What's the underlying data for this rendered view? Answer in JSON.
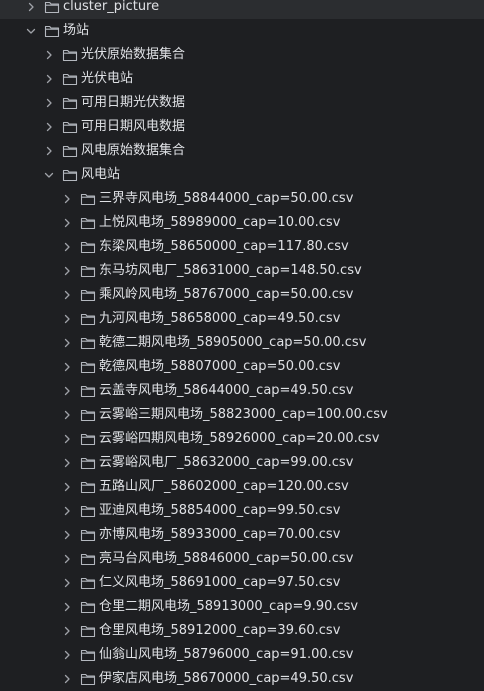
{
  "tree": [
    {
      "label": "cluster_picture",
      "level": 0,
      "expanded": false
    },
    {
      "label": "场站",
      "level": 0,
      "expanded": true
    },
    {
      "label": "光伏原始数据集合",
      "level": 1,
      "expanded": false
    },
    {
      "label": "光伏电站",
      "level": 1,
      "expanded": false
    },
    {
      "label": "可用日期光伏数据",
      "level": 1,
      "expanded": false
    },
    {
      "label": "可用日期风电数据",
      "level": 1,
      "expanded": false
    },
    {
      "label": "风电原始数据集合",
      "level": 1,
      "expanded": false
    },
    {
      "label": "风电站",
      "level": 1,
      "expanded": true
    },
    {
      "label": "三界寺风电场_58844000_cap=50.00.csv",
      "level": 2,
      "expanded": false
    },
    {
      "label": "上悦风电场_58989000_cap=10.00.csv",
      "level": 2,
      "expanded": false
    },
    {
      "label": "东梁风电场_58650000_cap=117.80.csv",
      "level": 2,
      "expanded": false
    },
    {
      "label": "东马坊风电厂_58631000_cap=148.50.csv",
      "level": 2,
      "expanded": false
    },
    {
      "label": "乘风岭风电场_58767000_cap=50.00.csv",
      "level": 2,
      "expanded": false
    },
    {
      "label": "九河风电场_58658000_cap=49.50.csv",
      "level": 2,
      "expanded": false
    },
    {
      "label": "乾德二期风电场_58905000_cap=50.00.csv",
      "level": 2,
      "expanded": false
    },
    {
      "label": "乾德风电场_58807000_cap=50.00.csv",
      "level": 2,
      "expanded": false
    },
    {
      "label": "云盖寺风电场_58644000_cap=49.50.csv",
      "level": 2,
      "expanded": false
    },
    {
      "label": "云雾峪三期风电场_58823000_cap=100.00.csv",
      "level": 2,
      "expanded": false
    },
    {
      "label": "云雾峪四期风电场_58926000_cap=20.00.csv",
      "level": 2,
      "expanded": false
    },
    {
      "label": "云雾峪风电厂_58632000_cap=99.00.csv",
      "level": 2,
      "expanded": false
    },
    {
      "label": "五路山风厂_58602000_cap=120.00.csv",
      "level": 2,
      "expanded": false
    },
    {
      "label": "亚迪风电场_58854000_cap=99.50.csv",
      "level": 2,
      "expanded": false
    },
    {
      "label": "亦博风电场_58933000_cap=70.00.csv",
      "level": 2,
      "expanded": false
    },
    {
      "label": "亮马台风电场_58846000_cap=50.00.csv",
      "level": 2,
      "expanded": false
    },
    {
      "label": "仁义风电场_58691000_cap=97.50.csv",
      "level": 2,
      "expanded": false
    },
    {
      "label": "仓里二期风电场_58913000_cap=9.90.csv",
      "level": 2,
      "expanded": false
    },
    {
      "label": "仓里风电场_58912000_cap=39.60.csv",
      "level": 2,
      "expanded": false
    },
    {
      "label": "仙翁山风电场_58796000_cap=91.00.csv",
      "level": 2,
      "expanded": false
    },
    {
      "label": "伊家店风电场_58670000_cap=49.50.csv",
      "level": 2,
      "expanded": false
    }
  ],
  "icons": {
    "chevron_collapsed": "chevron-right-icon",
    "chevron_expanded": "chevron-down-icon",
    "folder": "folder-icon"
  },
  "colors": {
    "background": "#1e1f22",
    "text": "#dfe1e5",
    "chevron": "#9fa2a8",
    "folder_stroke": "#b4b8bf"
  }
}
